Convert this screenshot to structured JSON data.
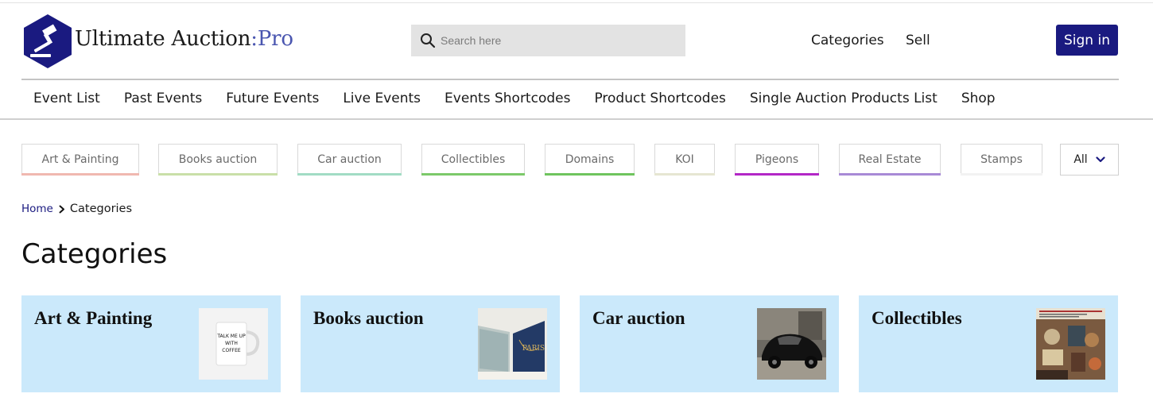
{
  "header": {
    "brand_main": "Ultimate Auction",
    "brand_sep": ":",
    "brand_accent": "Pro",
    "search_placeholder": "Search here",
    "links": {
      "categories": "Categories",
      "sell": "Sell"
    },
    "signin_label": "Sign in"
  },
  "nav": {
    "items": [
      "Event List",
      "Past Events",
      "Future Events",
      "Live Events",
      "Events Shortcodes",
      "Product Shortcodes",
      "Single Auction Products List",
      "Shop"
    ]
  },
  "category_tabs": [
    {
      "label": "Art & Painting",
      "color": "#f0b8b0"
    },
    {
      "label": "Books auction",
      "color": "#c9dfa8"
    },
    {
      "label": "Car auction",
      "color": "#a2dcc4"
    },
    {
      "label": "Collectibles",
      "color": "#7cc96a"
    },
    {
      "label": "Domains",
      "color": "#6fc45e"
    },
    {
      "label": "KOI",
      "color": "#e6e6d2"
    },
    {
      "label": "Pigeons",
      "color": "#b327c6"
    },
    {
      "label": "Real Estate",
      "color": "#a88ad6"
    },
    {
      "label": "Stamps",
      "color": "#f2f2f2"
    }
  ],
  "all_select": {
    "value": "All"
  },
  "breadcrumb": {
    "home": "Home",
    "current": "Categories"
  },
  "page_title": "Categories",
  "cards": [
    {
      "title": "Art & Painting",
      "mug_text": [
        "TALK ME UP",
        "WITH",
        "COFFEE"
      ]
    },
    {
      "title": "Books auction",
      "book_text": "PARIS"
    },
    {
      "title": "Car auction"
    },
    {
      "title": "Collectibles"
    }
  ],
  "colors": {
    "brand": "#1a1a80",
    "card_bg": "#cbe9fb",
    "accent_text": "#4a56b0"
  },
  "icons": {
    "logo": "gavel-hexagon-icon",
    "search": "search-icon",
    "breadcrumb_sep": "chevron-right-icon",
    "select": "chevron-down-icon"
  }
}
